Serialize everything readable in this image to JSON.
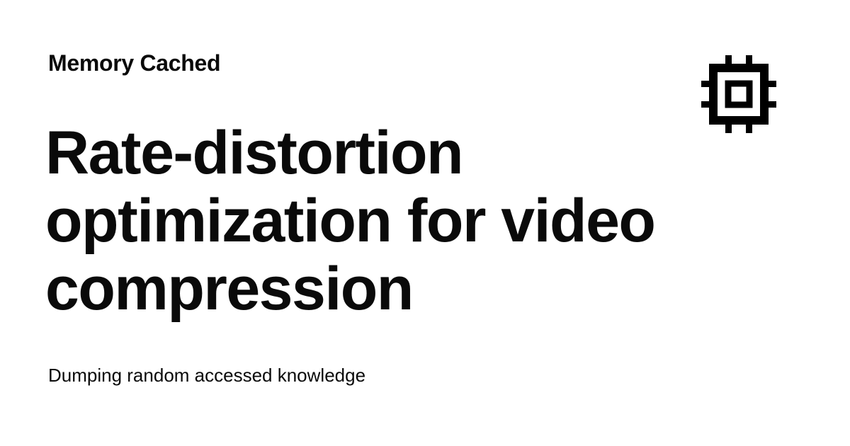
{
  "site": {
    "name": "Memory Cached",
    "tagline": "Dumping random accessed knowledge"
  },
  "post": {
    "title": "Rate-distortion optimization for video compression"
  },
  "logo": {
    "icon": "cpu-chip-icon",
    "color": "#000000"
  },
  "colors": {
    "background": "#ffffff",
    "text": "#0a0a0a"
  }
}
